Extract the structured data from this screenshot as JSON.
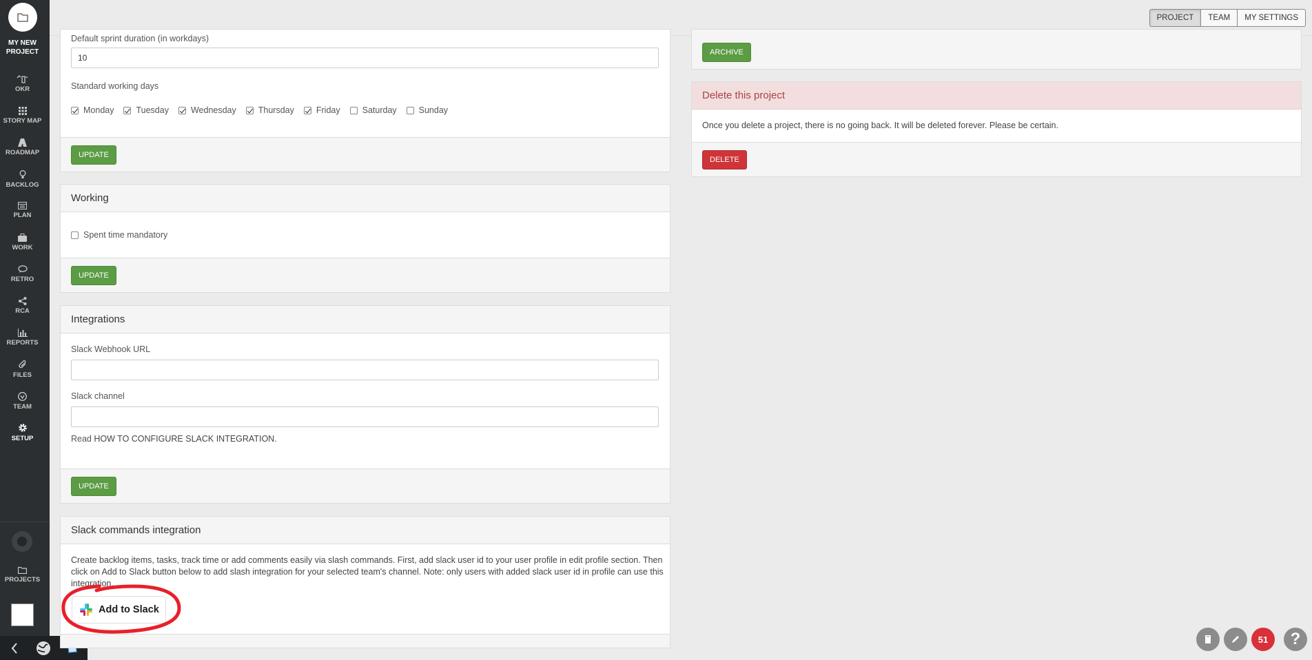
{
  "sidebar": {
    "project_name_line1": "MY NEW",
    "project_name_line2": "PROJECT",
    "items": [
      {
        "label": "OKR"
      },
      {
        "label": "STORY MAP"
      },
      {
        "label": "ROADMAP"
      },
      {
        "label": "BACKLOG"
      },
      {
        "label": "PLAN"
      },
      {
        "label": "WORK"
      },
      {
        "label": "RETRO"
      },
      {
        "label": "RCA"
      },
      {
        "label": "REPORTS"
      },
      {
        "label": "FILES"
      },
      {
        "label": "TEAM"
      },
      {
        "label": "SETUP"
      }
    ],
    "projects_label": "PROJECTS"
  },
  "topbar": {
    "tabs": [
      "PROJECT",
      "TEAM",
      "MY SETTINGS"
    ]
  },
  "sprint": {
    "duration_label": "Default sprint duration (in workdays)",
    "duration_value": "10",
    "working_days_label": "Standard working days",
    "days": [
      {
        "label": "Monday",
        "checked": true
      },
      {
        "label": "Tuesday",
        "checked": true
      },
      {
        "label": "Wednesday",
        "checked": true
      },
      {
        "label": "Thursday",
        "checked": true
      },
      {
        "label": "Friday",
        "checked": true
      },
      {
        "label": "Saturday",
        "checked": false
      },
      {
        "label": "Sunday",
        "checked": false
      }
    ],
    "update_label": "UPDATE"
  },
  "working": {
    "title": "Working",
    "spent_time_label": "Spent time mandatory",
    "spent_time_checked": false,
    "update_label": "UPDATE"
  },
  "integrations": {
    "title": "Integrations",
    "webhook_label": "Slack Webhook URL",
    "webhook_value": "",
    "channel_label": "Slack channel",
    "channel_value": "",
    "help_prefix": "Read ",
    "help_link": "HOW TO CONFIGURE SLACK INTEGRATION.",
    "update_label": "UPDATE"
  },
  "slack_commands": {
    "title": "Slack commands integration",
    "description": "Create backlog items, tasks, track time or add comments easily via slash commands. First, add slack user id to your user profile in edit profile section. Then click on Add to Slack button below to add slash integration for your selected team's channel. Note: only users with added slack user id in profile can use this integration.",
    "button_label": "Add to Slack"
  },
  "archive": {
    "button_label": "ARCHIVE"
  },
  "delete_project": {
    "title": "Delete this project",
    "description": "Once you delete a project, there is no going back. It will be deleted forever. Please be certain.",
    "button_label": "DELETE"
  },
  "floating": {
    "notification_count": "51",
    "help_glyph": "?"
  },
  "colors": {
    "sidebar_bg": "#2b2f31",
    "green": "#5b9c44",
    "red": "#cf3438",
    "delete_header_bg": "#f2dede",
    "delete_header_text": "#a94442",
    "annotation_circle": "#e8202a"
  }
}
